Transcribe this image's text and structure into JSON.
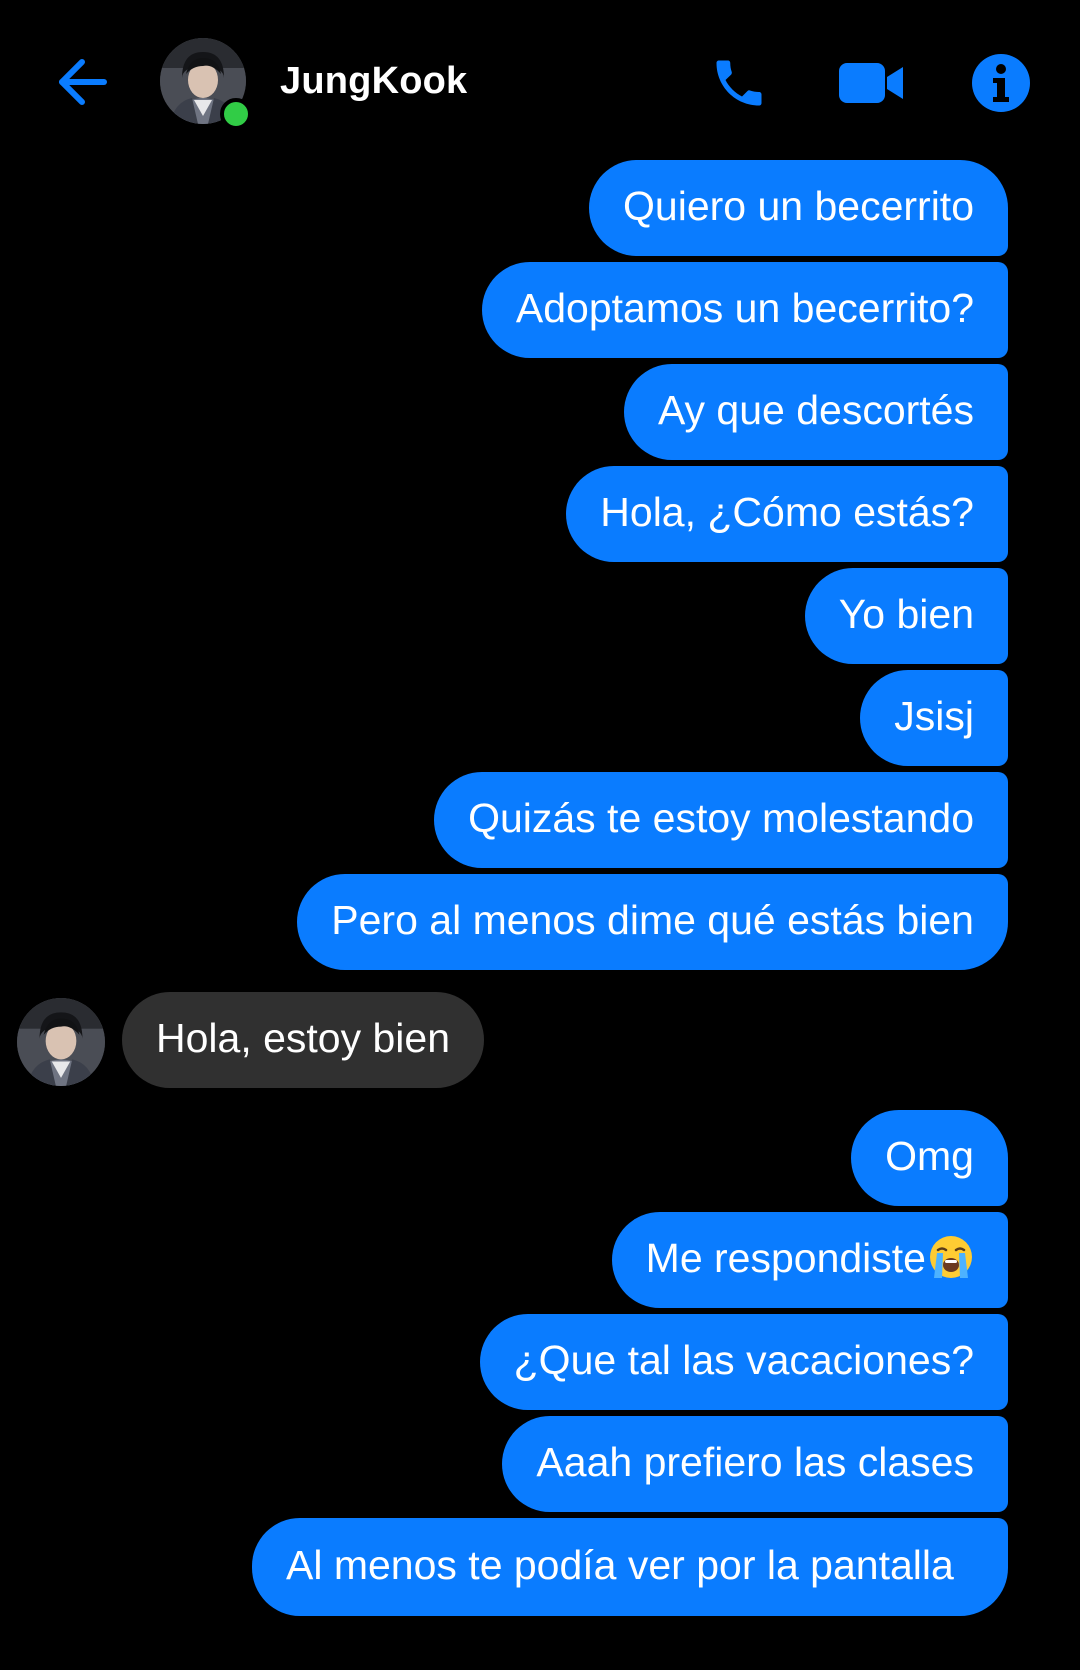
{
  "header": {
    "contact_name": "JungKook",
    "online_color": "#31cc46",
    "icons": [
      "back-arrow-icon",
      "phone-icon",
      "video-camera-icon",
      "info-icon"
    ],
    "accent_color": "#0a7cff"
  },
  "messages": [
    {
      "from": "me",
      "text": "Quiero un becerrito"
    },
    {
      "from": "me",
      "text": "Adoptamos un becerrito?"
    },
    {
      "from": "me",
      "text": "Ay que descortés"
    },
    {
      "from": "me",
      "text": "Hola, ¿Cómo estás?"
    },
    {
      "from": "me",
      "text": "Yo bien"
    },
    {
      "from": "me",
      "text": "Jsisj"
    },
    {
      "from": "me",
      "text": "Quizás te estoy molestando"
    },
    {
      "from": "me",
      "text": "Pero al menos dime qué estás bien"
    },
    {
      "from": "them",
      "text": "Hola, estoy bien"
    },
    {
      "from": "me",
      "text": "Omg"
    },
    {
      "from": "me",
      "text": "Me respondiste",
      "emoji": "loudly-crying-face-emoji"
    },
    {
      "from": "me",
      "text": "¿Que tal las vacaciones?"
    },
    {
      "from": "me",
      "text": "Aaah prefiero las clases"
    },
    {
      "from": "me",
      "text": "Al menos te podía ver por la pantalla"
    }
  ],
  "colors": {
    "outgoing_bubble": "#0a7cff",
    "incoming_bubble": "#303030",
    "background": "#000000"
  }
}
